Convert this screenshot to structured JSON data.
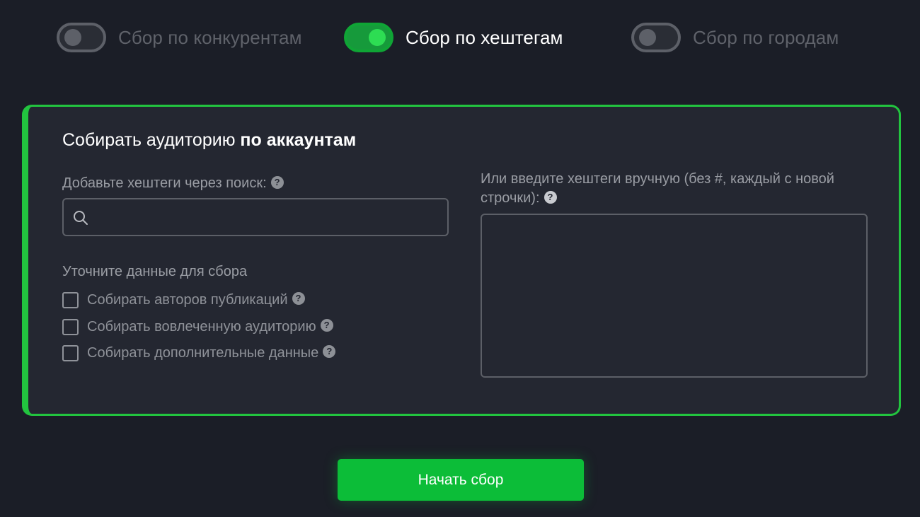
{
  "modes": [
    {
      "label": "Сбор по конкурентам",
      "enabled": false
    },
    {
      "label": "Сбор по хештегам",
      "enabled": true
    },
    {
      "label": "Сбор по городам",
      "enabled": false
    }
  ],
  "card": {
    "title_prefix": "Собирать аудиторию ",
    "title_bold": "по аккаунтам",
    "search_label": "Добавьте хештеги через поиск:",
    "search_value": "",
    "manual_label": "Или введите хештеги вручную (без #, каждый с новой строчки):",
    "manual_value": "",
    "options_title": "Уточните данные для сбора",
    "options": [
      {
        "label": "Собирать авторов публикаций",
        "checked": false
      },
      {
        "label": "Собирать вовлеченную аудиторию",
        "checked": false
      },
      {
        "label": "Собирать дополнительные данные",
        "checked": false
      }
    ]
  },
  "help_glyph": "?",
  "start_button_label": "Начать сбор",
  "colors": {
    "background": "#1b1e27",
    "card": "#242731",
    "accent": "#22c43f",
    "button": "#0cbd38",
    "muted_text": "#9a9da4"
  },
  "icons": {
    "search": "search-icon",
    "help": "help-icon"
  }
}
